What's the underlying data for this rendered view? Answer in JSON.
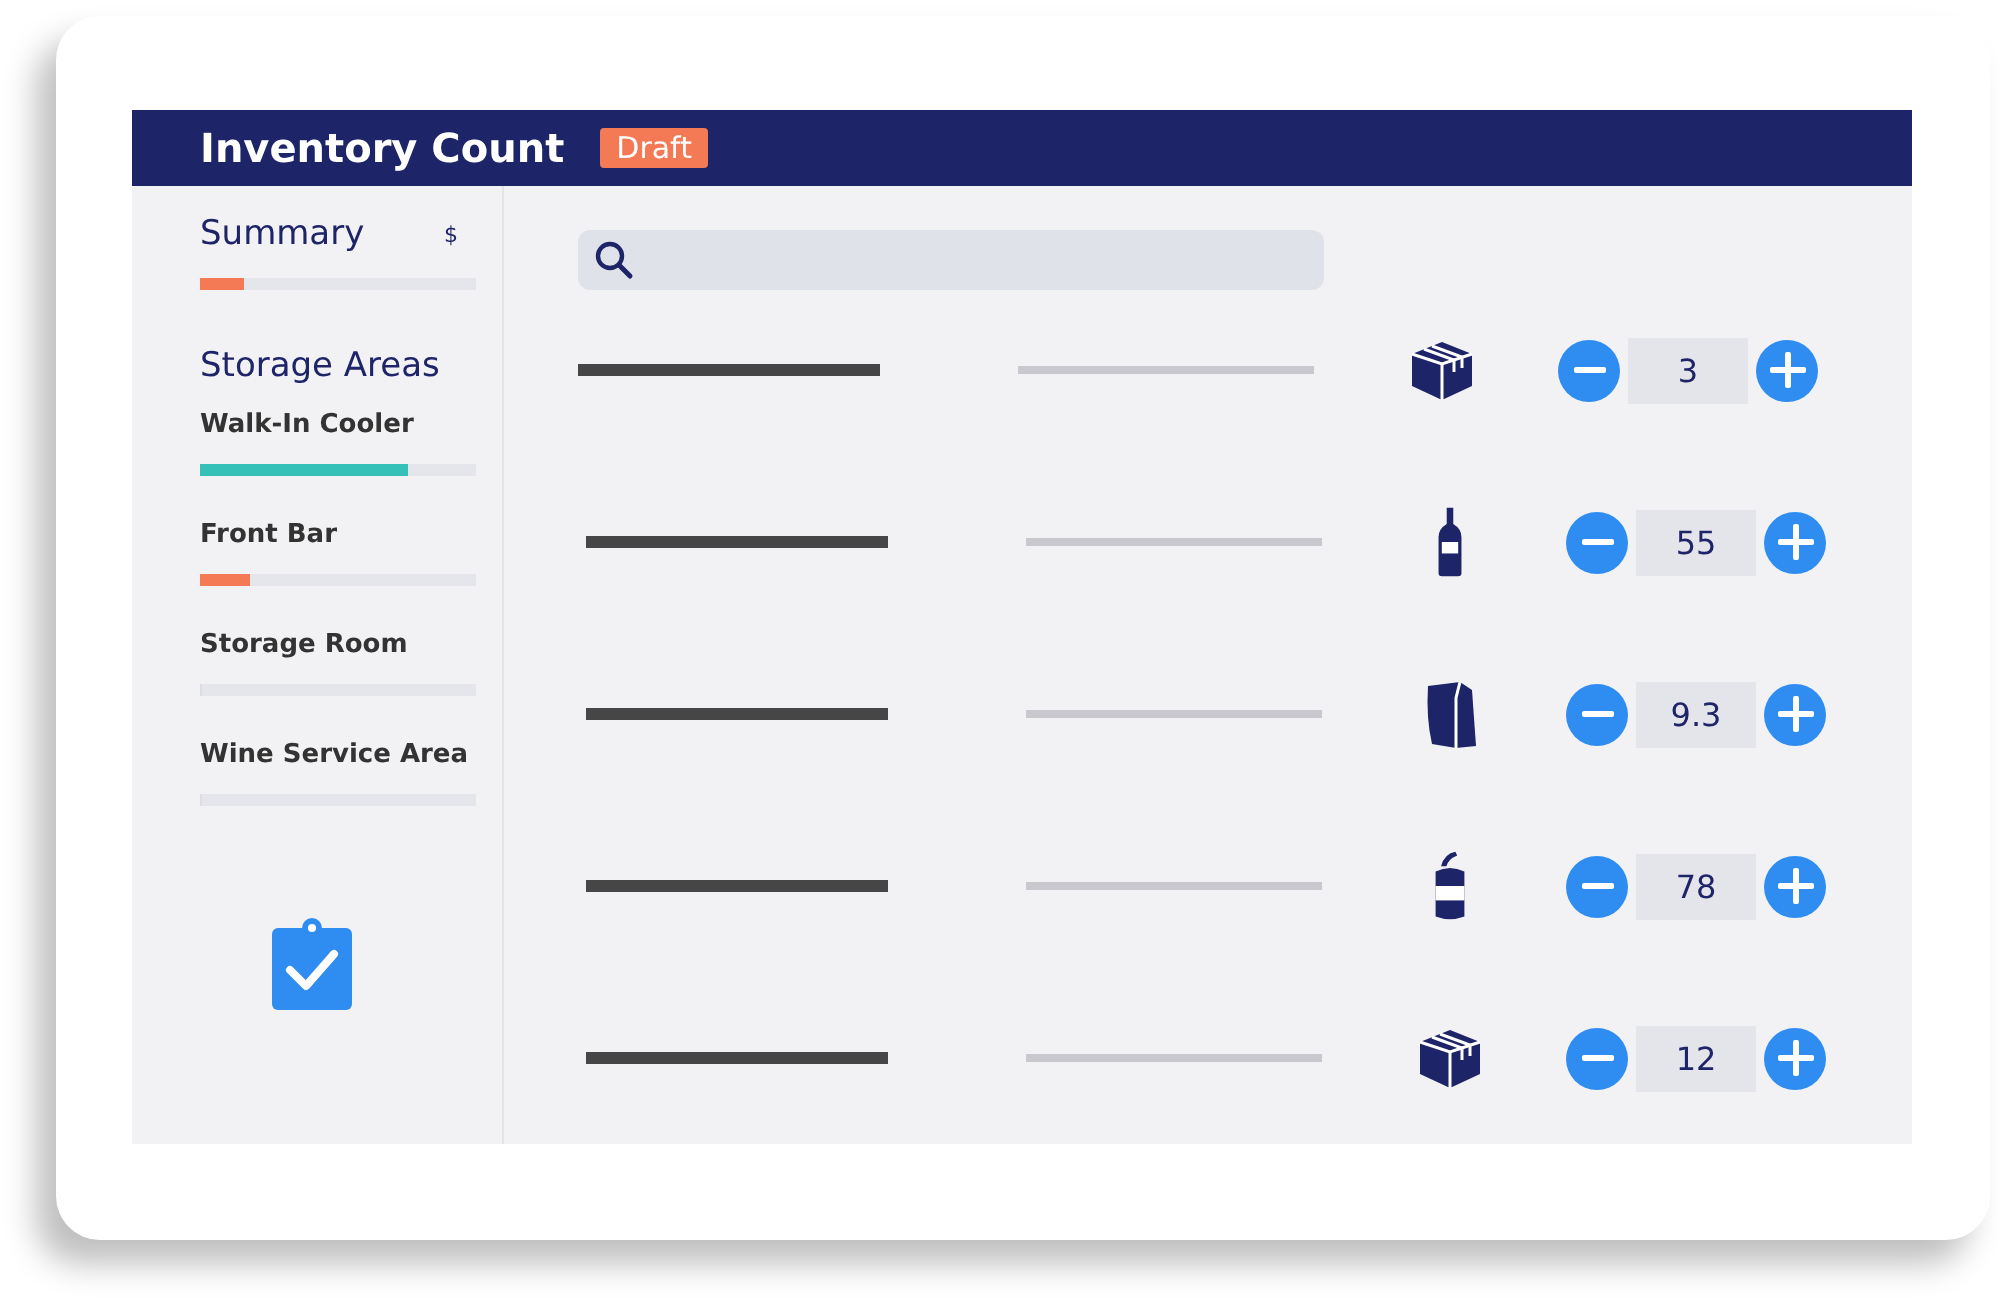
{
  "header": {
    "title": "Inventory Count",
    "badge": "Draft"
  },
  "summary": {
    "label": "Summary",
    "currency": "$",
    "level": 0.16,
    "color": "#f47a55"
  },
  "storage": {
    "heading": "Storage Areas",
    "areas": [
      {
        "name": "Walk-In Cooler",
        "level": 0.75,
        "color": "#35c1b8"
      },
      {
        "name": "Front Bar",
        "level": 0.18,
        "color": "#f47a55"
      },
      {
        "name": "Storage Room",
        "level": 0
      },
      {
        "name": "Wine Service Area",
        "level": 0
      }
    ]
  },
  "items": [
    {
      "kind": "box",
      "quantity": "3"
    },
    {
      "kind": "bottle",
      "quantity": "55"
    },
    {
      "kind": "bag",
      "quantity": "9.3"
    },
    {
      "kind": "can",
      "quantity": "78"
    },
    {
      "kind": "box",
      "quantity": "12"
    }
  ]
}
